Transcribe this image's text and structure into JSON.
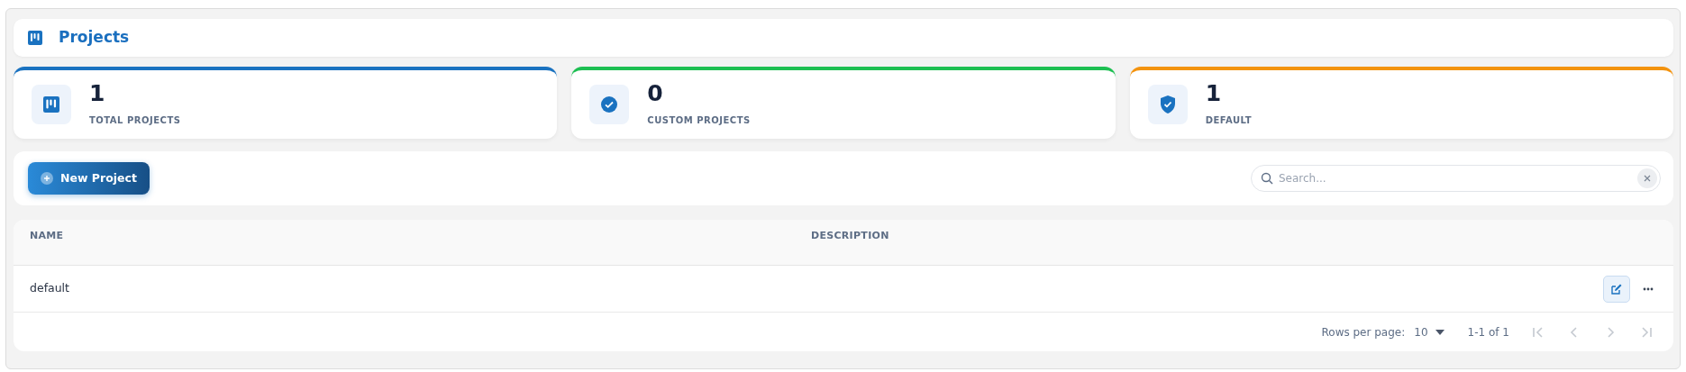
{
  "header": {
    "title": "Projects"
  },
  "stats": [
    {
      "kind": "total",
      "value": "1",
      "label": "TOTAL PROJECTS",
      "color": "#1a72c0"
    },
    {
      "kind": "custom",
      "value": "0",
      "label": "CUSTOM PROJECTS",
      "color": "#1dbf52"
    },
    {
      "kind": "default",
      "value": "1",
      "label": "DEFAULT",
      "color": "#f3930f"
    }
  ],
  "toolbar": {
    "new_button": "New Project",
    "search": {
      "placeholder": "Search..."
    }
  },
  "table": {
    "columns": [
      "NAME",
      "DESCRIPTION"
    ],
    "rows": [
      {
        "name": "default",
        "description": ""
      }
    ]
  },
  "pagination": {
    "rows_per_page_label": "Rows per page:",
    "rows_per_page": "10",
    "range": "1-1 of 1",
    "buttons": [
      {
        "kind": "first",
        "disabled": true
      },
      {
        "kind": "prev",
        "disabled": true
      },
      {
        "kind": "next",
        "disabled": true
      },
      {
        "kind": "last",
        "disabled": true
      }
    ]
  }
}
